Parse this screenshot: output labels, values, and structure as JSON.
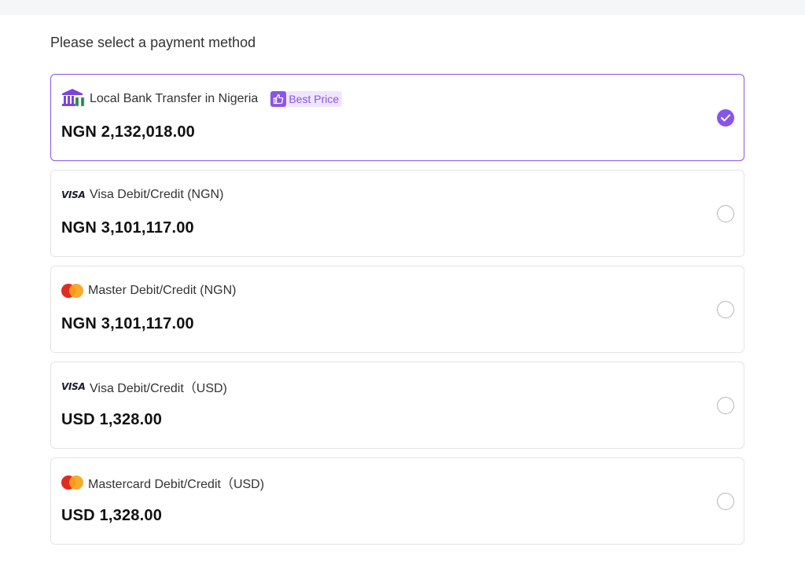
{
  "page": {
    "title": "Please select a payment method"
  },
  "options": [
    {
      "label": "Local Bank Transfer in Nigeria",
      "amount": "NGN 2,132,018.00",
      "icon": "bank-icon",
      "badge": "Best Price",
      "selected": true
    },
    {
      "label": "Visa Debit/Credit (NGN)",
      "amount": "NGN 3,101,117.00",
      "icon": "visa-icon",
      "icon_text": "VISA",
      "selected": false
    },
    {
      "label": "Master Debit/Credit (NGN)",
      "amount": "NGN 3,101,117.00",
      "icon": "mastercard-icon",
      "selected": false
    },
    {
      "label": "Visa Debit/Credit（USD)",
      "amount": "USD 1,328.00",
      "icon": "visa-icon",
      "icon_text": "VISA",
      "selected": false
    },
    {
      "label": "Mastercard Debit/Credit（USD)",
      "amount": "USD 1,328.00",
      "icon": "mastercard-icon",
      "selected": false
    }
  ],
  "colors": {
    "accent": "#8b54e8",
    "border": "#e3e3e6",
    "badge_bg": "#efe6fd"
  }
}
